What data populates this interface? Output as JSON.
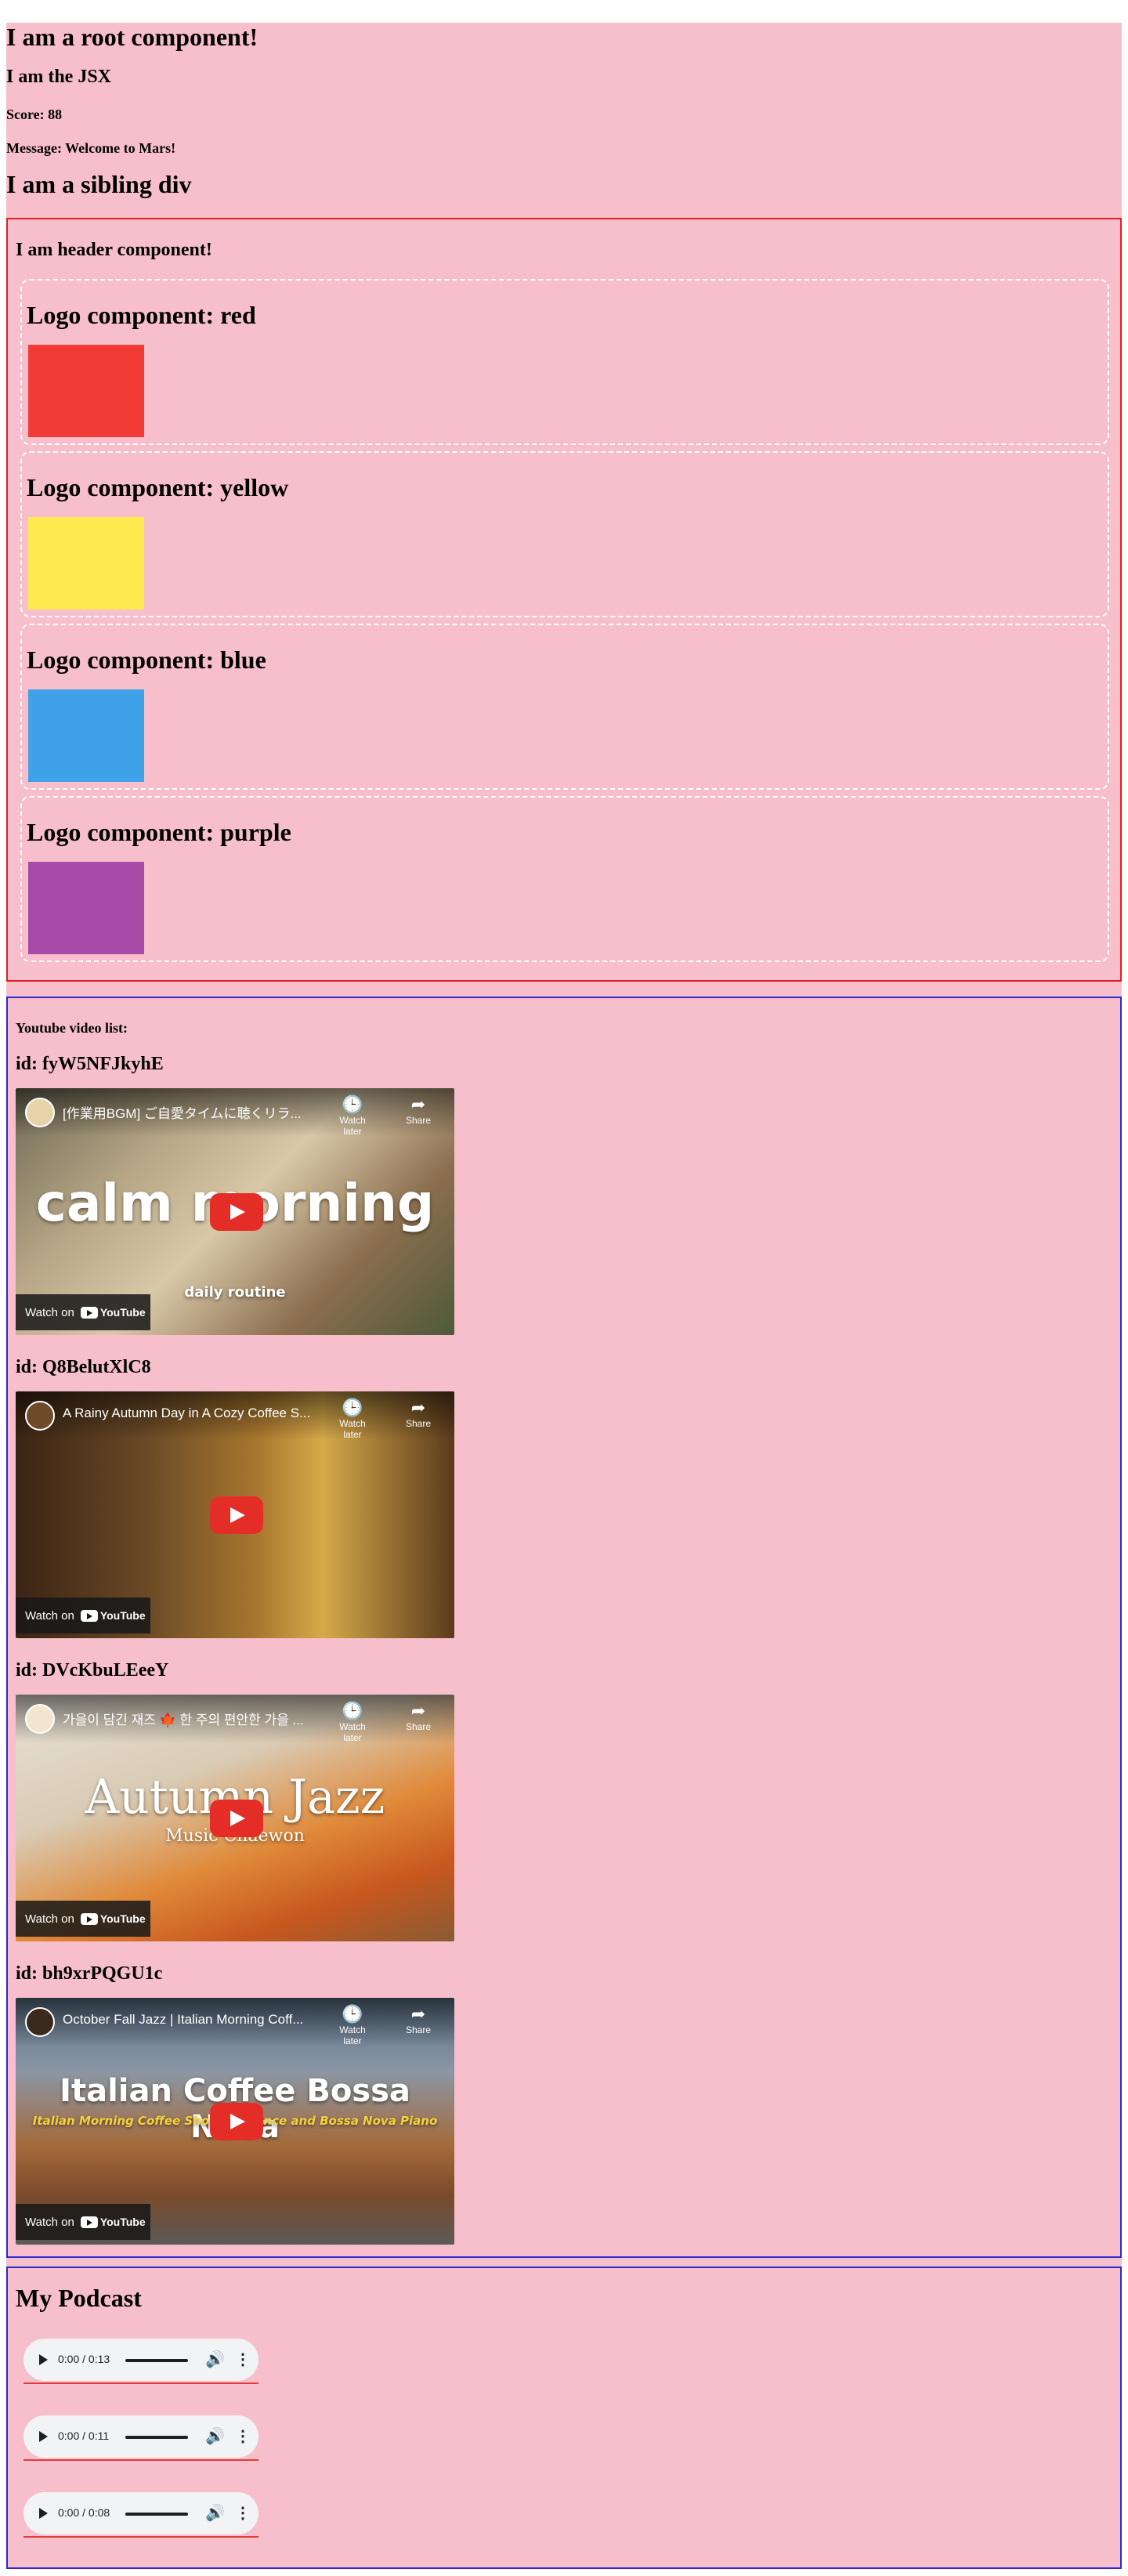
{
  "root": {
    "title": "I am a root component!",
    "jsx": "I am the JSX",
    "score": "Score: 88",
    "message": "Message: Welcome to Mars!",
    "sibling": "I am a sibling div"
  },
  "header": {
    "title": "I am header component!",
    "logos": [
      {
        "label": "Logo component: red",
        "color": "#f03b36"
      },
      {
        "label": "Logo component: yellow",
        "color": "#ffeb4f"
      },
      {
        "label": "Logo component: blue",
        "color": "#3fa2e8"
      },
      {
        "label": "Logo component: purple",
        "color": "#a74aa8"
      }
    ]
  },
  "youtube": {
    "title": "Youtube video list:",
    "watch_later": "Watch later",
    "share": "Share",
    "watch_on": "Watch on",
    "youtube_word": "YouTube",
    "videos": [
      {
        "id_label": "id: fyW5NFJkyhE",
        "video_title": "[作業用BGM] ご自愛タイムに聴くリラ...",
        "overlay_text": "calm morning",
        "overlay_sub": "daily routine"
      },
      {
        "id_label": "id: Q8BelutXlC8",
        "video_title": "A Rainy Autumn Day in A Cozy Coffee S...",
        "overlay_text": "",
        "overlay_sub": ""
      },
      {
        "id_label": "id: DVcKbuLEeeY",
        "video_title": "가을이 담긴 재즈 🍁 한 주의 편안한 가을 ...",
        "overlay_text": "Autumn Jazz",
        "overlay_sub": "Music Chaewon"
      },
      {
        "id_label": "id: bh9xrPQGU1c",
        "video_title": "October Fall Jazz | Italian Morning Coff...",
        "overlay_text": "Italian Coffee Bossa Nova",
        "overlay_sub": "Italian Morning Coffee Shop Ambience and Bossa Nova Piano"
      }
    ]
  },
  "podcast": {
    "title": "My Podcast",
    "tracks": [
      {
        "time": "0:00 / 0:13"
      },
      {
        "time": "0:00 / 0:11"
      },
      {
        "time": "0:00 / 0:08"
      }
    ]
  },
  "colors": {
    "background": "#f7bfcb",
    "header_border": "#e02020",
    "section_border": "#2a2ad0",
    "play_button": "#e52d27"
  }
}
